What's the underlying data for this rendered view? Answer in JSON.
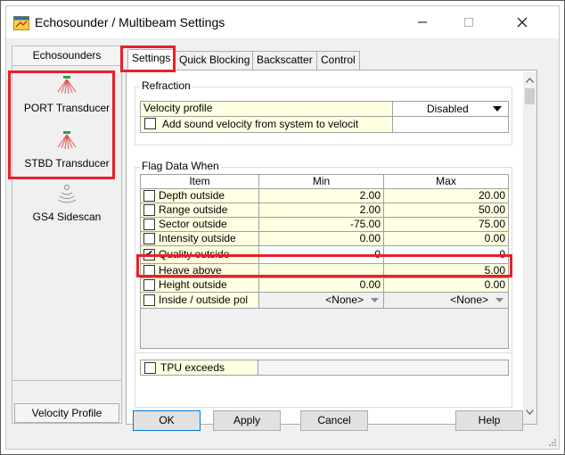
{
  "window": {
    "title": "Echosounder / Multibeam Settings",
    "caption_minimize": "—",
    "caption_maximize": "☐",
    "caption_close": "✕"
  },
  "left_panel": {
    "header": "Echosounders",
    "devices": [
      {
        "label": "PORT Transducer",
        "icon": "multibeam-icon",
        "color": "#2ea043"
      },
      {
        "label": "STBD Transducer",
        "icon": "multibeam-icon",
        "color": "#2ea043"
      },
      {
        "label": "GS4 Sidescan",
        "icon": "sidescan-icon",
        "color": "#8a8a8a"
      }
    ],
    "velocity_profile_button": "Velocity Profile"
  },
  "tabs": [
    "Settings",
    "Quick Blocking",
    "Backscatter",
    "Control"
  ],
  "refraction": {
    "title": "Refraction",
    "velocity_profile_label": "Velocity profile",
    "velocity_profile_value": "Disabled",
    "add_sound_velocity_label": "Add sound velocity from system to velocit",
    "add_sound_velocity_checked": false
  },
  "flag_data": {
    "title": "Flag Data When",
    "columns": [
      "Item",
      "Min",
      "Max"
    ],
    "rows": [
      {
        "label": "Depth outside",
        "checked": false,
        "min": "2.00",
        "max": "20.00"
      },
      {
        "label": "Range outside",
        "checked": false,
        "min": "2.00",
        "max": "50.00"
      },
      {
        "label": "Sector outside",
        "checked": false,
        "min": "-75.00",
        "max": "75.00"
      },
      {
        "label": "Intensity outside",
        "checked": false,
        "min": "0.00",
        "max": "0.00"
      },
      {
        "label": "Quality outside",
        "checked": true,
        "min": "0",
        "max": "0"
      },
      {
        "label": "Heave above",
        "checked": false,
        "min": "",
        "max": "5.00"
      },
      {
        "label": "Height outside",
        "checked": false,
        "min": "0.00",
        "max": "0.00"
      },
      {
        "label": "Inside / outside pol",
        "checked": false,
        "min": "<None>",
        "max": "<None>"
      }
    ]
  },
  "tpu": {
    "label": "TPU exceeds",
    "checked": false
  },
  "buttons": {
    "ok": "OK",
    "apply": "Apply",
    "cancel": "Cancel",
    "help": "Help"
  },
  "colors": {
    "highlight": "#e8202a",
    "cell_yellow": "#ffffe1",
    "accent": "#0078d7"
  }
}
